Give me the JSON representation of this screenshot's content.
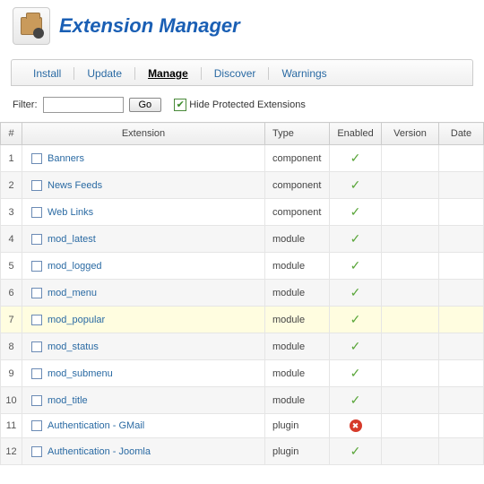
{
  "header": {
    "title": "Extension Manager"
  },
  "tabs": {
    "items": [
      {
        "label": "Install",
        "active": false
      },
      {
        "label": "Update",
        "active": false
      },
      {
        "label": "Manage",
        "active": true
      },
      {
        "label": "Discover",
        "active": false
      },
      {
        "label": "Warnings",
        "active": false
      }
    ]
  },
  "filter": {
    "label": "Filter:",
    "value": "",
    "go_label": "Go",
    "hide_protected_checked": true,
    "hide_protected_label": "Hide Protected Extensions"
  },
  "columns": {
    "num": "#",
    "extension": "Extension",
    "type": "Type",
    "enabled": "Enabled",
    "version": "Version",
    "date": "Date"
  },
  "rows": [
    {
      "n": "1",
      "name": "Banners",
      "type": "component",
      "enabled": true,
      "version": "",
      "date": "",
      "hl": false
    },
    {
      "n": "2",
      "name": "News Feeds",
      "type": "component",
      "enabled": true,
      "version": "",
      "date": "",
      "hl": false
    },
    {
      "n": "3",
      "name": "Web Links",
      "type": "component",
      "enabled": true,
      "version": "",
      "date": "",
      "hl": false
    },
    {
      "n": "4",
      "name": "mod_latest",
      "type": "module",
      "enabled": true,
      "version": "",
      "date": "",
      "hl": false
    },
    {
      "n": "5",
      "name": "mod_logged",
      "type": "module",
      "enabled": true,
      "version": "",
      "date": "",
      "hl": false
    },
    {
      "n": "6",
      "name": "mod_menu",
      "type": "module",
      "enabled": true,
      "version": "",
      "date": "",
      "hl": false
    },
    {
      "n": "7",
      "name": "mod_popular",
      "type": "module",
      "enabled": true,
      "version": "",
      "date": "",
      "hl": true
    },
    {
      "n": "8",
      "name": "mod_status",
      "type": "module",
      "enabled": true,
      "version": "",
      "date": "",
      "hl": false
    },
    {
      "n": "9",
      "name": "mod_submenu",
      "type": "module",
      "enabled": true,
      "version": "",
      "date": "",
      "hl": false
    },
    {
      "n": "10",
      "name": "mod_title",
      "type": "module",
      "enabled": true,
      "version": "",
      "date": "",
      "hl": false
    },
    {
      "n": "11",
      "name": "Authentication - GMail",
      "type": "plugin",
      "enabled": false,
      "version": "",
      "date": "",
      "hl": false
    },
    {
      "n": "12",
      "name": "Authentication - Joomla",
      "type": "plugin",
      "enabled": true,
      "version": "",
      "date": "",
      "hl": false
    }
  ]
}
